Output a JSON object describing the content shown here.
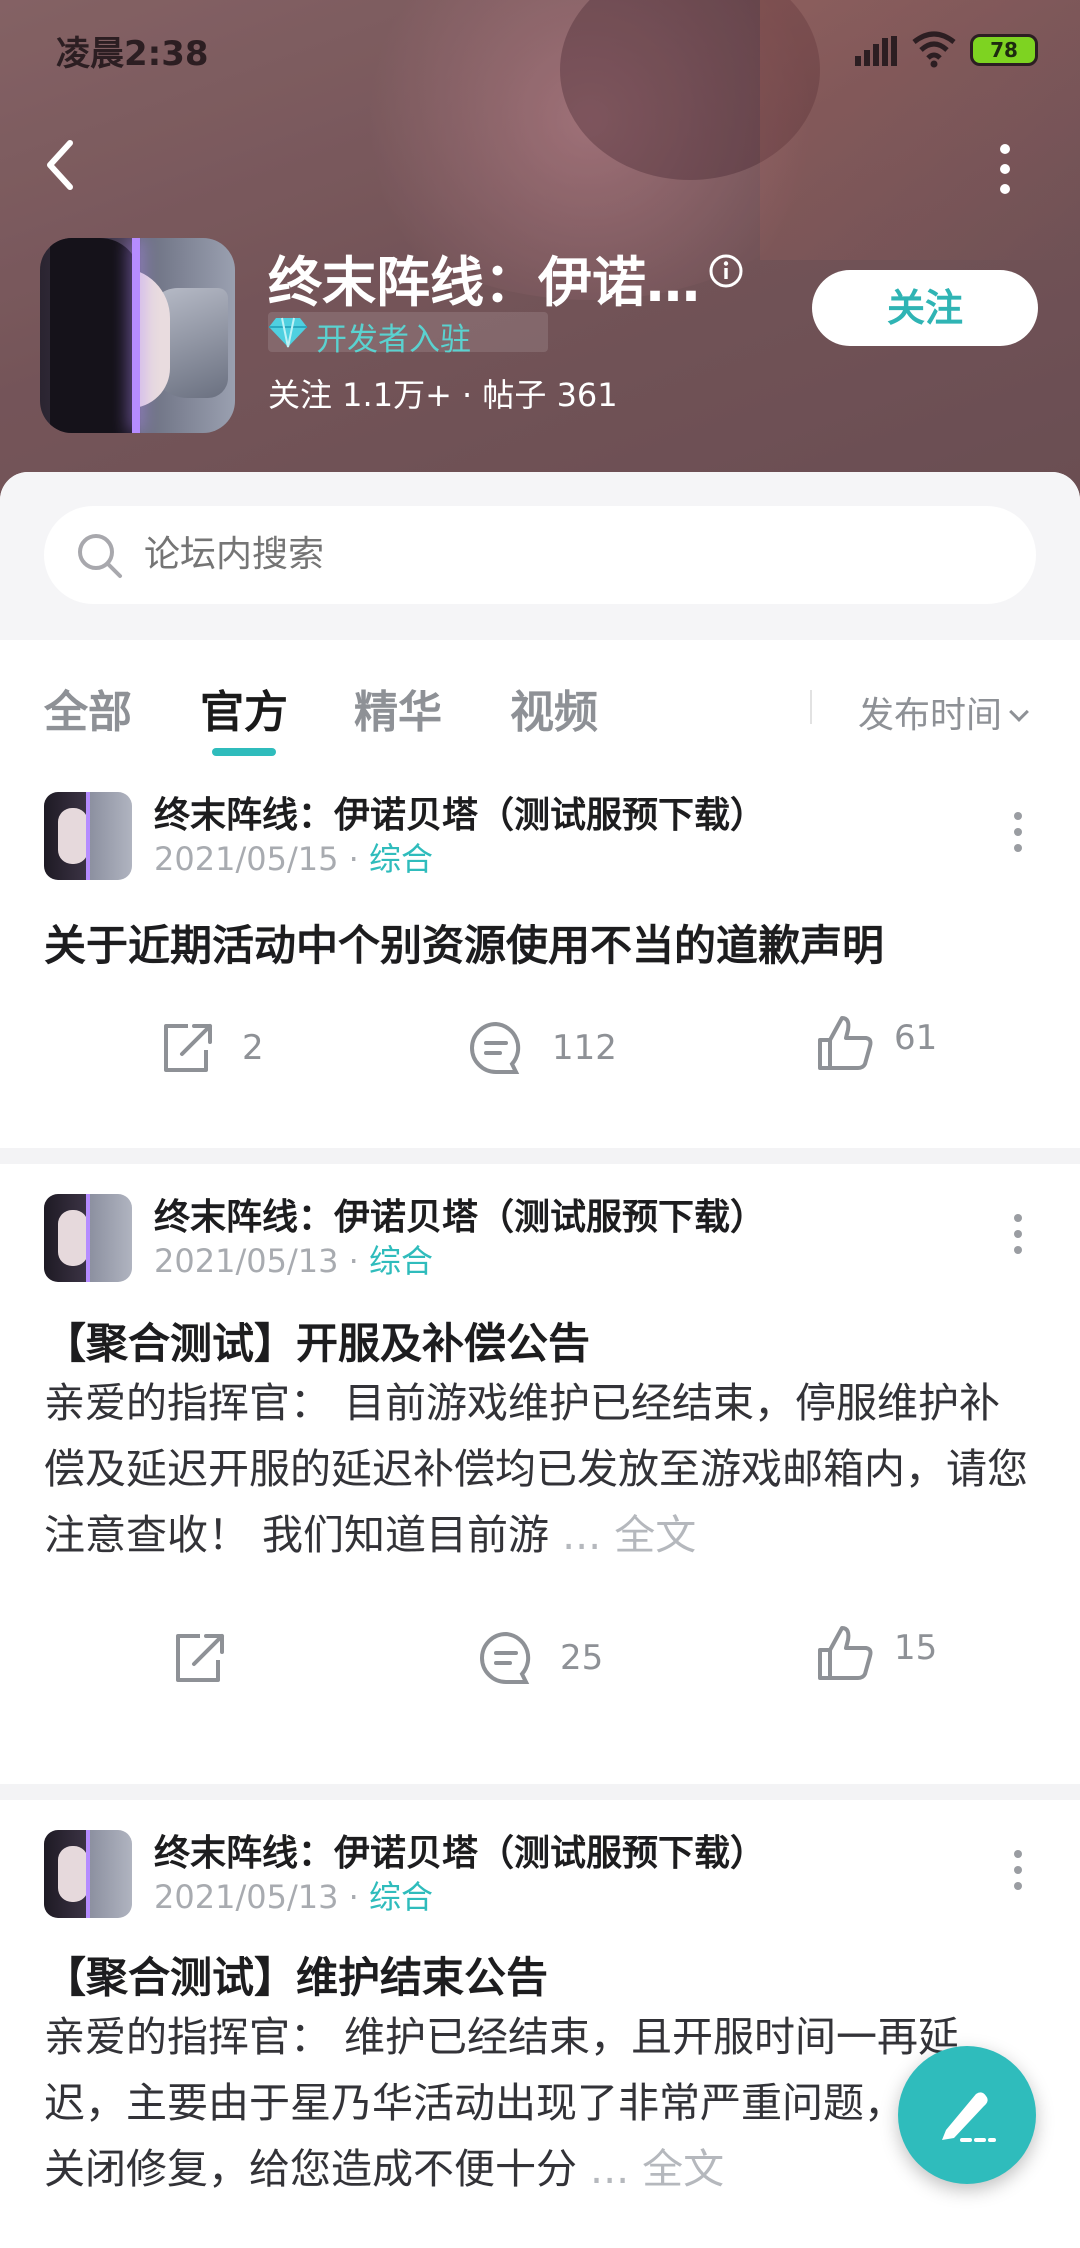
{
  "status_bar": {
    "time": "凌晨2:38",
    "battery": "78"
  },
  "header": {
    "title": "终末阵线：伊诺…",
    "developer_badge": "开发者入驻",
    "stats": "关注 1.1万+ · 帖子 361",
    "follow_label": "关注"
  },
  "search": {
    "placeholder": "论坛内搜索"
  },
  "tabs": [
    {
      "label": "全部"
    },
    {
      "label": "官方"
    },
    {
      "label": "精华"
    },
    {
      "label": "视频"
    }
  ],
  "sort": {
    "label": "发布时间"
  },
  "posts": [
    {
      "author": "终末阵线：伊诺贝塔（测试服预下载）",
      "date": "2021/05/15",
      "separator": "·",
      "category": "综合",
      "title": "关于近期活动中个别资源使用不当的道歉声明",
      "body": "",
      "share_count": "2",
      "comment_count": "112",
      "like_count": "61"
    },
    {
      "author": "终末阵线：伊诺贝塔（测试服预下载）",
      "date": "2021/05/13",
      "separator": "·",
      "category": "综合",
      "title": "【聚合测试】开服及补偿公告",
      "body": "亲爱的指挥官： 目前游戏维护已经结束，停服维护补偿及延迟开服的延迟补偿均已发放至游戏邮箱内，请您注意查收！   我们知道目前游",
      "more_label": "... 全文",
      "share_count": "",
      "comment_count": "25",
      "like_count": "15"
    },
    {
      "author": "终末阵线：伊诺贝塔（测试服预下载）",
      "date": "2021/05/13",
      "separator": "·",
      "category": "综合",
      "title": "【聚合测试】维护结束公告",
      "body": "亲爱的指挥官： 维护已经结束，且开服时间一再延迟，主要由于星乃华活动出现了非常严重问题，故紧急关闭修复，给您造成不便十分",
      "more_label": "... 全文"
    }
  ],
  "colors": {
    "accent": "#2fbcbc",
    "header_bg": "#7b5a5e"
  },
  "icons": [
    "back-icon",
    "more-icon",
    "info-icon",
    "diamond-icon",
    "search-icon",
    "share-icon",
    "comment-icon",
    "like-icon",
    "edit-icon"
  ]
}
